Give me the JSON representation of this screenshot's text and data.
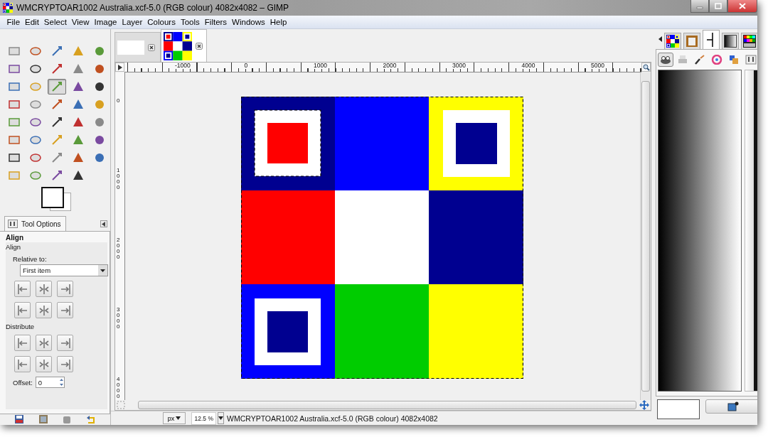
{
  "window": {
    "title": "WMCRYPTOAR1002 Australia.xcf-5.0 (RGB colour) 4082x4082 – GIMP"
  },
  "menu": [
    "File",
    "Edit",
    "Select",
    "View",
    "Image",
    "Layer",
    "Colours",
    "Tools",
    "Filters",
    "Windows",
    "Help"
  ],
  "toolbox": {
    "tools": [
      {
        "selected": false
      },
      {
        "selected": false
      },
      {
        "selected": false
      },
      {
        "selected": false
      },
      {
        "selected": false
      },
      {
        "selected": false
      },
      {
        "selected": false
      },
      {
        "selected": false
      },
      {
        "selected": false
      },
      {
        "selected": false
      },
      {
        "selected": false
      },
      {
        "selected": false
      },
      {
        "selected": true
      },
      {
        "selected": false
      },
      {
        "selected": false
      },
      {
        "selected": false
      },
      {
        "selected": false
      },
      {
        "selected": false
      },
      {
        "selected": false
      },
      {
        "selected": false
      },
      {
        "selected": false
      },
      {
        "selected": false
      },
      {
        "selected": false
      },
      {
        "selected": false
      },
      {
        "selected": false
      },
      {
        "selected": false
      },
      {
        "selected": false
      },
      {
        "selected": false
      },
      {
        "selected": false
      },
      {
        "selected": false
      },
      {
        "selected": false
      },
      {
        "selected": false
      },
      {
        "selected": false
      },
      {
        "selected": false
      },
      {
        "selected": false
      },
      {
        "selected": false
      },
      {
        "selected": false
      },
      {
        "selected": false
      },
      {
        "selected": false
      }
    ]
  },
  "tool_options": {
    "tab": "Tool Options",
    "heading": "Align",
    "section": "Align",
    "relative_label": "Relative to:",
    "relative_value": "First item",
    "distribute_label": "Distribute",
    "offset_label": "Offset:",
    "offset_value": "0"
  },
  "image_tabs": [
    {
      "selected": false
    },
    {
      "selected": true
    }
  ],
  "rulers": {
    "horizontal": [
      "-1000",
      "0",
      "1000",
      "2000",
      "3000",
      "4000",
      "5000"
    ],
    "vertical": [
      "0",
      "1000",
      "2000",
      "3000",
      "4000"
    ]
  },
  "status_bar": {
    "unit": "px",
    "zoom": "12.5 %",
    "text": "WMCRYPTOAR1002 Australia.xcf-5.0 (RGB colour) 4082x4082"
  },
  "dock": {
    "tabs": [
      {
        "selected": false
      },
      {
        "selected": false
      },
      {
        "selected": true
      },
      {
        "selected": false
      },
      {
        "selected": false
      }
    ],
    "buttons": [
      {
        "selected": true
      },
      {
        "selected": false
      },
      {
        "selected": false
      },
      {
        "selected": false
      },
      {
        "selected": false
      },
      {
        "selected": false
      }
    ]
  }
}
